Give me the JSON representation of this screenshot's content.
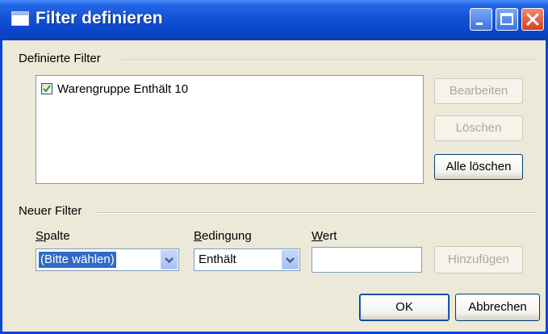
{
  "window": {
    "title": "Filter definieren",
    "title_icon": "window-icon",
    "controls": [
      "minimize-icon",
      "maximize-icon",
      "close-icon"
    ]
  },
  "defined_filters": {
    "group_label": "Definierte Filter",
    "items": [
      {
        "label": "Warengruppe Enthält 10",
        "checked": true
      }
    ],
    "buttons": {
      "edit": "Bearbeiten",
      "delete": "Löschen",
      "delete_all": "Alle löschen"
    }
  },
  "new_filter": {
    "group_label": "Neuer Filter",
    "column": {
      "label": "Spalte",
      "value": "(Bitte wählen)"
    },
    "condition": {
      "label": "Bedingung",
      "value": "Enthält"
    },
    "value": {
      "label": "Wert",
      "value": ""
    },
    "add_button": "Hinzufügen"
  },
  "footer": {
    "ok": "OK",
    "cancel": "Abbrechen"
  },
  "colors": {
    "titlebar": "#0a45c8",
    "dialog_bg": "#ece9d8",
    "selection": "#316ac5",
    "close_button": "#d4401f"
  }
}
